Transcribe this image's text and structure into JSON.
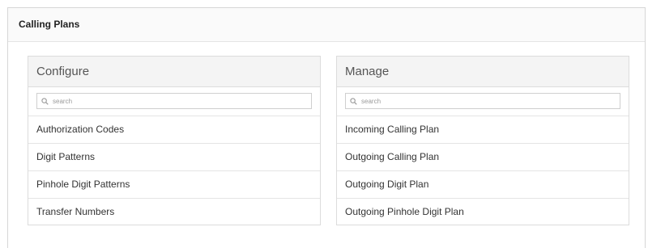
{
  "section": {
    "title": "Calling Plans"
  },
  "configure": {
    "title": "Configure",
    "search_placeholder": "search",
    "items": [
      {
        "label": "Authorization Codes"
      },
      {
        "label": "Digit Patterns"
      },
      {
        "label": "Pinhole Digit Patterns"
      },
      {
        "label": "Transfer Numbers"
      }
    ]
  },
  "manage": {
    "title": "Manage",
    "search_placeholder": "search",
    "items": [
      {
        "label": "Incoming Calling Plan"
      },
      {
        "label": "Outgoing Calling Plan"
      },
      {
        "label": "Outgoing Digit Plan"
      },
      {
        "label": "Outgoing Pinhole Digit Plan"
      }
    ]
  },
  "icons": {
    "search": "search-icon"
  },
  "colors": {
    "panel_header_bg": "#f4f4f4",
    "border": "#dcdcdc",
    "text": "#333333"
  }
}
